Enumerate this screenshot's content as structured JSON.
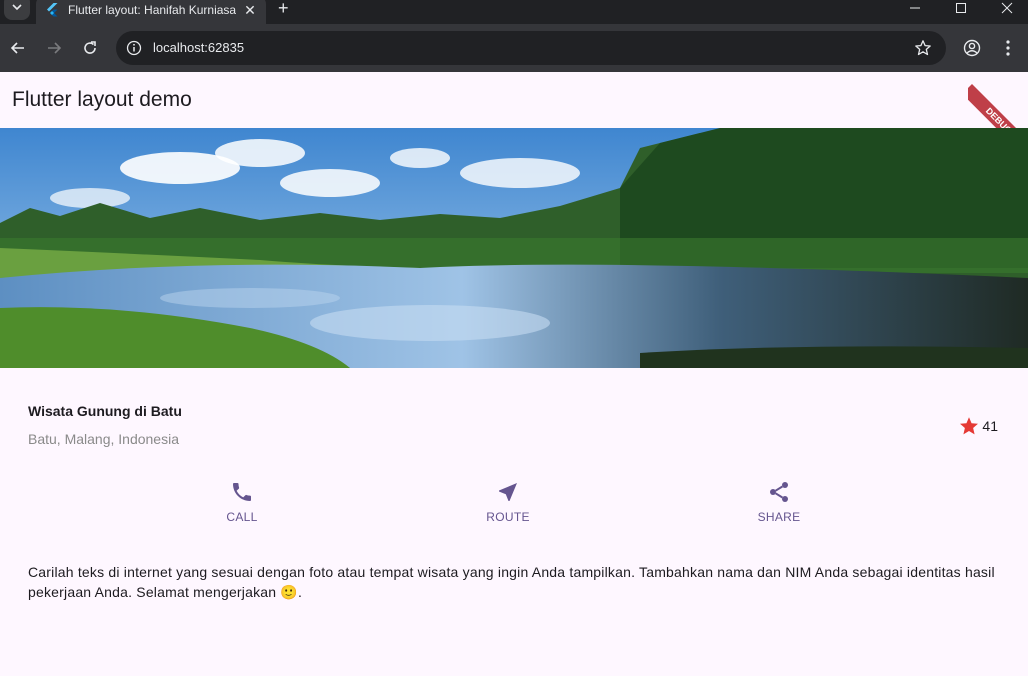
{
  "browser": {
    "tab_title": "Flutter layout: Hanifah Kurniasari",
    "url": "localhost:62835"
  },
  "app": {
    "title": "Flutter layout demo",
    "debug_label": "DEBUG"
  },
  "place": {
    "name": "Wisata Gunung di Batu",
    "location": "Batu, Malang, Indonesia",
    "rating": "41"
  },
  "actions": [
    {
      "label": "CALL",
      "icon": "phone-icon"
    },
    {
      "label": "ROUTE",
      "icon": "near-me-icon"
    },
    {
      "label": "SHARE",
      "icon": "share-icon"
    }
  ],
  "description": "Carilah teks di internet yang sesuai dengan foto atau tempat wisata yang ingin Anda tampilkan. Tambahkan nama dan NIM Anda sebagai identitas hasil pekerjaan Anda. Selamat mengerjakan 🙂.",
  "colors": {
    "primary": "#65558f",
    "star": "#e53935",
    "background": "#fef7ff"
  }
}
